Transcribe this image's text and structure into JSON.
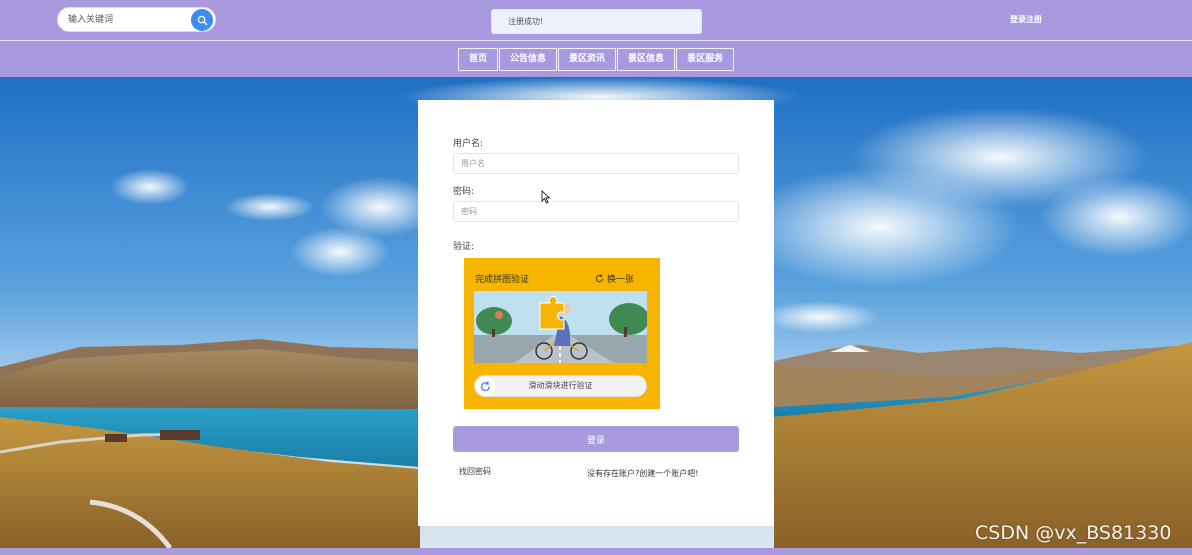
{
  "header": {
    "search_placeholder": "输入关键词",
    "toast": "注册成功!",
    "login_link": "登录注册"
  },
  "nav": {
    "items": [
      {
        "label": "首页"
      },
      {
        "label": "公告信息"
      },
      {
        "label": "景区资讯"
      },
      {
        "label": "景区信息"
      },
      {
        "label": "景区服务"
      }
    ]
  },
  "login": {
    "username_label": "用户名:",
    "username_placeholder": "用户名",
    "password_label": "密码:",
    "password_placeholder": "密码",
    "verify_label": "验证:",
    "captcha_title": "完成拼图验证",
    "captcha_refresh": "换一张",
    "slider_text": "滑动滑块进行验证",
    "submit": "登录",
    "forgot": "找回密码",
    "register": "没有存在账户?创建一个账户吧!"
  },
  "watermark": "CSDN @vx_BS81330",
  "colors": {
    "brand": "#a99ae0",
    "search_button": "#3d8cf0",
    "captcha_bg": "#f7b500"
  }
}
